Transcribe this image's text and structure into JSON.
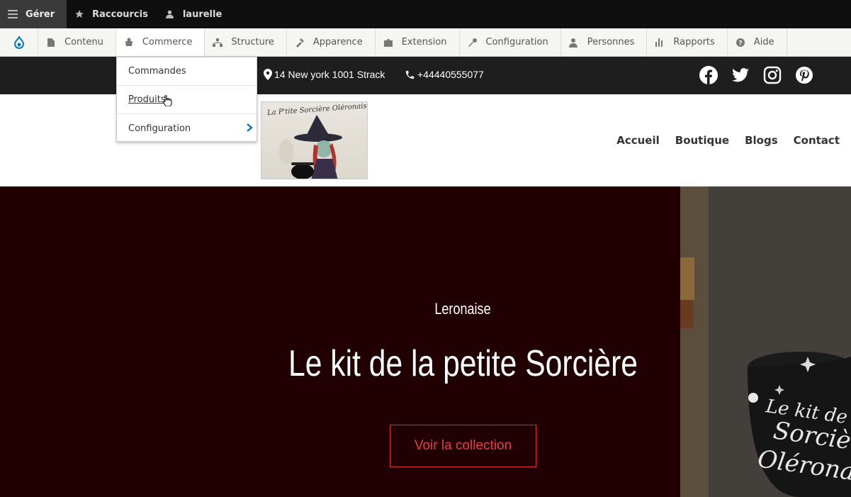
{
  "admin_bar": {
    "manage": "Gérer",
    "shortcuts": "Raccourcis",
    "user": "laurelle"
  },
  "toolbar": {
    "items": [
      "Contenu",
      "Commerce",
      "Structure",
      "Apparence",
      "Extension",
      "Configuration",
      "Personnes",
      "Rapports",
      "Aide"
    ]
  },
  "dropdown": {
    "items": [
      "Commandes",
      "Produits",
      "Configuration"
    ]
  },
  "info": {
    "address": "14 New york 1001 Strack",
    "phone": "+44440555077"
  },
  "logo": {
    "text": "La P'tite Sorcière Oléronaise"
  },
  "nav": {
    "items": [
      "Accueil",
      "Boutique",
      "Blogs",
      "Contact"
    ]
  },
  "hero": {
    "subtitle": "Leronaise",
    "title": "Le kit de la petite Sorcière",
    "cta": "Voir la collection",
    "photo_text_1": "Le kit de la",
    "photo_text_2": "Sorcière",
    "photo_text_3": "Oléronaise"
  },
  "icons": {
    "admin": [
      "menu-icon",
      "star-icon",
      "user-icon"
    ],
    "social": [
      "facebook-icon",
      "twitter-icon",
      "instagram-icon",
      "pinterest-icon"
    ]
  },
  "colors": {
    "hero_bg": "#210004",
    "cta_accent": "#d8283c",
    "drupal_blue": "#0678be"
  }
}
